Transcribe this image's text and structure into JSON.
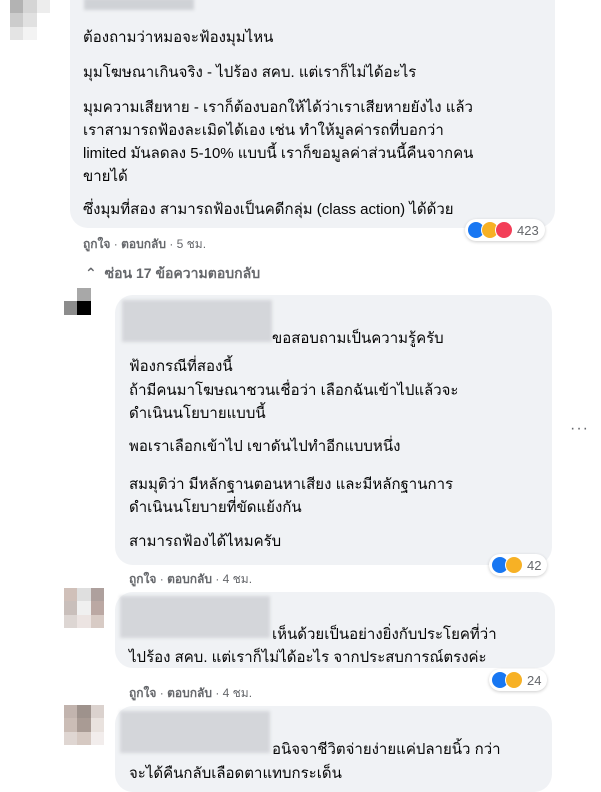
{
  "comment1": {
    "lines": [
      "ต้องถามว่าหมอจะฟ้องมุมไหน",
      "มุมโฆษณาเกินจริง - ไปร้อง สคบ. แต่เราก็ไม่ได้อะไร",
      "มุมความเสียหาย - เราก็ต้องบอกให้ได้ว่าเราเสียหายยังไง แล้ว",
      "เราสามารถฟ้องละเมิดได้เอง เช่น ทำให้มูลค่ารถที่บอกว่า",
      "limited มันลดลง 5-10% แบบนี้ เราก็ขอมูลค่าส่วนนี้คืนจากคน",
      "ขายได้",
      "ซึ่งมุมที่สอง สามารถฟ้องเป็นคดีกลุ่ม (class action) ได้ด้วย"
    ],
    "like_label": "ถูกใจ",
    "reply_label": "ตอบกลับ",
    "time": "5 ชม.",
    "reaction_count": "423",
    "reactions": [
      "like-icon",
      "wow-icon",
      "love-icon"
    ]
  },
  "hide_replies_label": "ซ่อน 17 ข้อความตอบกลับ",
  "reply1": {
    "lines": [
      "ขอสอบถามเป็นความรู้ครับ",
      "ฟ้องกรณีที่สองนี้",
      "ถ้ามีคนมาโฆษณาชวนเชื่อว่า เลือกฉันเข้าไปแล้วจะ",
      "ดำเนินนโยบายแบบนี้",
      "พอเราเลือกเข้าไป เขาดันไปทำอีกแบบหนึ่ง",
      "สมมุติว่า มีหลักฐานตอนหาเสียง และมีหลักฐานการ",
      "ดำเนินนโยบายที่ขัดแย้งกัน",
      "สามารถฟ้องได้ไหมครับ"
    ],
    "like_label": "ถูกใจ",
    "reply_label": "ตอบกลับ",
    "time": "4 ชม.",
    "reaction_count": "42",
    "reactions": [
      "like-icon",
      "haha-icon"
    ]
  },
  "reply2": {
    "lines": [
      "เห็นด้วยเป็นอย่างยิ่งกับประโยคที่ว่า",
      "ไปร้อง สคบ. แต่เราก็ไม่ได้อะไร จากประสบการณ์ตรงค่ะ"
    ],
    "like_label": "ถูกใจ",
    "reply_label": "ตอบกลับ",
    "time": "4 ชม.",
    "reaction_count": "24",
    "reactions": [
      "like-icon",
      "sad-icon"
    ]
  },
  "reply3": {
    "lines": [
      "อนิจจาชีวิตจ่ายง่ายแค่ปลายนิ้ว กว่า",
      "จะได้คืนกลับเลือดตาแทบกระเด็น"
    ]
  },
  "more_options_icon": "ellipsis-icon",
  "colors": {
    "bubble": "#f0f2f5",
    "like": "#1877f2",
    "love": "#f33e58",
    "wow": "#f7b125",
    "meta_text": "#65676b"
  }
}
